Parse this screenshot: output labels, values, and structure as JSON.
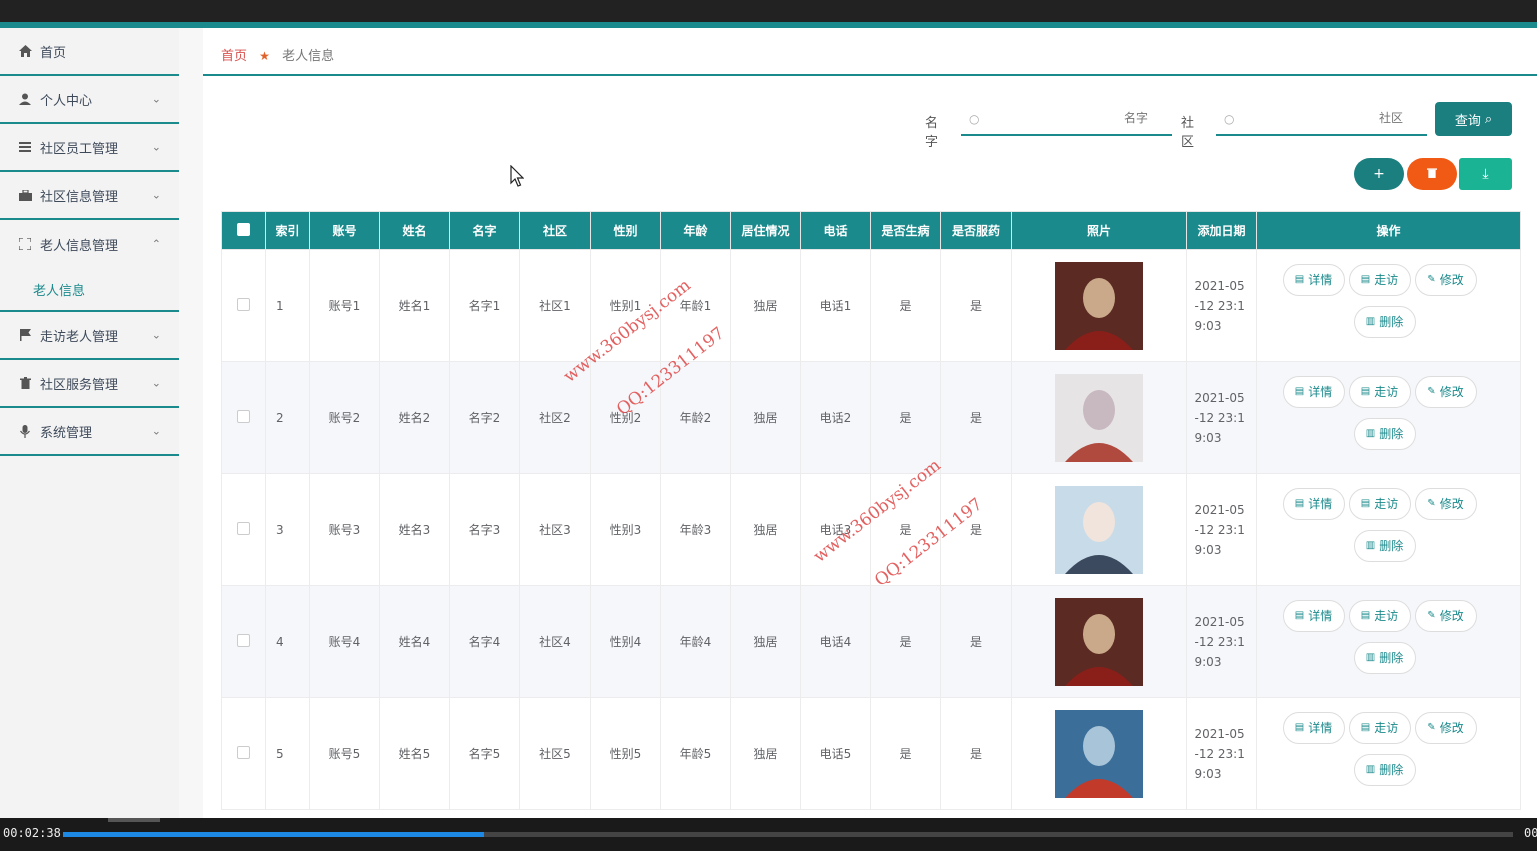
{
  "sidebar": {
    "items": [
      {
        "label": "首页",
        "icon": "home-icon",
        "expandable": false
      },
      {
        "label": "个人中心",
        "icon": "user-icon",
        "expandable": true
      },
      {
        "label": "社区员工管理",
        "icon": "list-icon",
        "expandable": true
      },
      {
        "label": "社区信息管理",
        "icon": "briefcase-icon",
        "expandable": true
      },
      {
        "label": "老人信息管理",
        "icon": "expand-icon",
        "expandable": true,
        "expanded": true
      },
      {
        "label": "走访老人管理",
        "icon": "flag-icon",
        "expandable": true
      },
      {
        "label": "社区服务管理",
        "icon": "trash-icon",
        "expandable": true
      },
      {
        "label": "系统管理",
        "icon": "mic-icon",
        "expandable": true
      }
    ],
    "sub_item": "老人信息"
  },
  "breadcrumb": {
    "home": "首页",
    "current": "老人信息"
  },
  "search": {
    "name_label": "名字",
    "name_placeholder": "名字",
    "community_label": "社区",
    "community_placeholder": "社区",
    "query_label": "查询"
  },
  "actions": {
    "add": "+",
    "delete": "🗑",
    "export": "⤓"
  },
  "table": {
    "headers": [
      "索引",
      "账号",
      "姓名",
      "名字",
      "社区",
      "性别",
      "年龄",
      "居住情况",
      "电话",
      "是否生病",
      "是否服药",
      "照片",
      "添加日期",
      "操作"
    ],
    "rows": [
      [
        "1",
        "账号1",
        "姓名1",
        "名字1",
        "社区1",
        "性别1",
        "年龄1",
        "独居",
        "电话1",
        "是",
        "是",
        "2021-05-12 23:19:03"
      ],
      [
        "2",
        "账号2",
        "姓名2",
        "名字2",
        "社区2",
        "性别2",
        "年龄2",
        "独居",
        "电话2",
        "是",
        "是",
        "2021-05-12 23:19:03"
      ],
      [
        "3",
        "账号3",
        "姓名3",
        "名字3",
        "社区3",
        "性别3",
        "年龄3",
        "独居",
        "电话3",
        "是",
        "是",
        "2021-05-12 23:19:03"
      ],
      [
        "4",
        "账号4",
        "姓名4",
        "名字4",
        "社区4",
        "性别4",
        "年龄4",
        "独居",
        "电话4",
        "是",
        "是",
        "2021-05-12 23:19:03"
      ],
      [
        "5",
        "账号5",
        "姓名5",
        "名字5",
        "社区5",
        "性别5",
        "年龄5",
        "独居",
        "电话5",
        "是",
        "是",
        "2021-05-12 23:19:03"
      ]
    ],
    "ops": {
      "detail": "详情",
      "visit": "走访",
      "edit": "修改",
      "delete": "删除"
    }
  },
  "watermarks": [
    "www.360bysj.com",
    "QQ:123311197"
  ],
  "player": {
    "current_time": "00:02:38",
    "end_time": "00",
    "progress": 0.29
  },
  "colors": {
    "accent": "#1b8a8c",
    "delete": "#f05a14",
    "export": "#1ab394",
    "link": "#d9534f"
  }
}
